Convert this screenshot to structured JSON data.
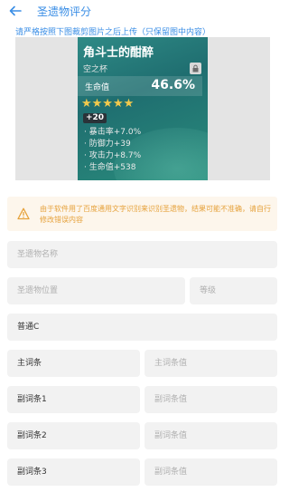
{
  "header": {
    "title": "圣遗物评分",
    "back_icon": "arrow-left-icon"
  },
  "hint": "请严格按照下图裁剪图片之后上传（只保留图中内容）",
  "artifact_card": {
    "name": "角斗士的酣醉",
    "type": "空之杯",
    "main_stat_label": "生命值",
    "main_stat_value": "46.6%",
    "stars": "★★★★★",
    "level": "+20",
    "substats": [
      "· 暴击率+7.0%",
      "· 防御力+39",
      "· 攻击力+8.7%",
      "· 生命值+538"
    ]
  },
  "warning": {
    "text": "由于软件用了百度通用文字识别来识别圣遗物，结果可能不准确，请自行修改错误内容",
    "color": "#e6a23c"
  },
  "form": {
    "name_placeholder": "圣遗物名称",
    "position_placeholder": "圣遗物位置",
    "level_placeholder": "等级",
    "quality_value": "普通C",
    "main_label": "主词条",
    "main_placeholder": "主词条值",
    "sub1_label": "副词条1",
    "sub1_placeholder": "副词条值",
    "sub2_label": "副词条2",
    "sub2_placeholder": "副词条值",
    "sub3_label": "副词条3",
    "sub3_placeholder": "副词条值"
  },
  "colors": {
    "accent": "#3a8ee6",
    "warning": "#e6a23c",
    "field_bg": "#f2f2f2"
  }
}
